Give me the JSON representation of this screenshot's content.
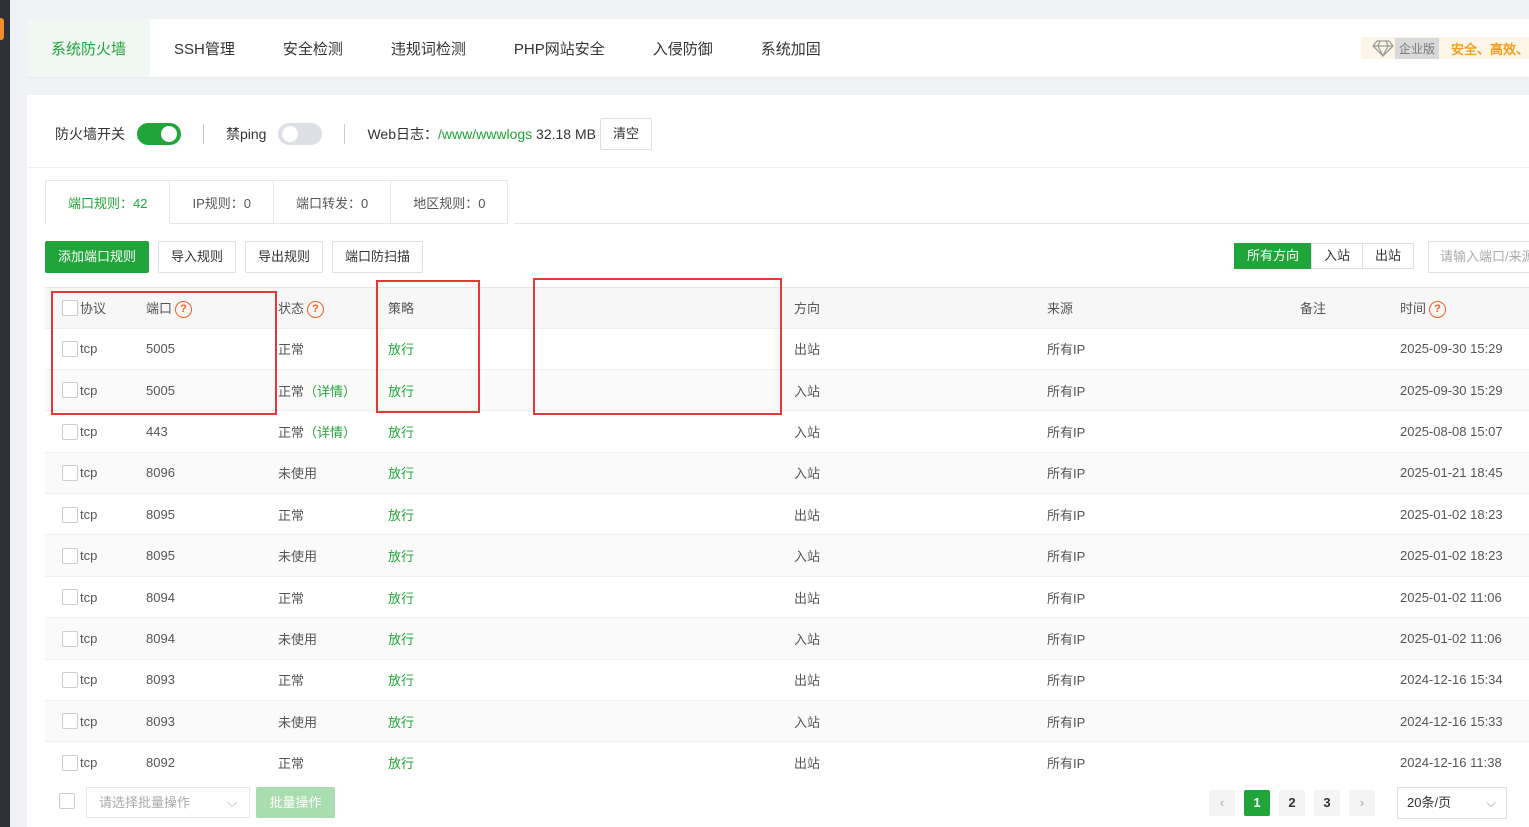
{
  "nav": {
    "tabs": [
      "系统防火墙",
      "SSH管理",
      "安全检测",
      "违规词检测",
      "PHP网站安全",
      "入侵防御",
      "系统加固"
    ],
    "active_index": 0,
    "enterprise": {
      "label": "企业版",
      "slogan": "安全、高效、"
    }
  },
  "switches": {
    "firewall_label": "防火墙开关",
    "firewall_on": true,
    "ping_label": "禁ping",
    "ping_on": false,
    "weblog_label": "Web日志：",
    "weblog_path": "/www/wwwlogs",
    "weblog_size": "32.18 MB",
    "clear_label": "清空"
  },
  "subtabs": [
    "端口规则：42",
    "IP规则：0",
    "端口转发：0",
    "地区规则：0"
  ],
  "toolbar": {
    "add_label": "添加端口规则",
    "import_label": "导入规则",
    "export_label": "导出规则",
    "scan_label": "端口防扫描"
  },
  "direction_filter": {
    "all": "所有方向",
    "in": "入站",
    "out": "出站"
  },
  "search": {
    "placeholder": "请输入端口/来源"
  },
  "table": {
    "headers": {
      "protocol": "协议",
      "port": "端口",
      "status": "状态",
      "policy": "策略",
      "direction": "方向",
      "source": "来源",
      "remark": "备注",
      "time": "时间"
    },
    "rows": [
      {
        "protocol": "tcp",
        "port": "5005",
        "status": "正常",
        "detail": "",
        "policy": "放行",
        "direction": "出站",
        "source": "所有IP",
        "remark": "",
        "time": "2025-09-30 15:29"
      },
      {
        "protocol": "tcp",
        "port": "5005",
        "status": "正常",
        "detail": "（详情）",
        "policy": "放行",
        "direction": "入站",
        "source": "所有IP",
        "remark": "",
        "time": "2025-09-30 15:29"
      },
      {
        "protocol": "tcp",
        "port": "443",
        "status": "正常",
        "detail": "（详情）",
        "policy": "放行",
        "direction": "入站",
        "source": "所有IP",
        "remark": "",
        "time": "2025-08-08 15:07"
      },
      {
        "protocol": "tcp",
        "port": "8096",
        "status": "未使用",
        "detail": "",
        "policy": "放行",
        "direction": "入站",
        "source": "所有IP",
        "remark": "",
        "time": "2025-01-21 18:45"
      },
      {
        "protocol": "tcp",
        "port": "8095",
        "status": "正常",
        "detail": "",
        "policy": "放行",
        "direction": "出站",
        "source": "所有IP",
        "remark": "",
        "time": "2025-01-02 18:23"
      },
      {
        "protocol": "tcp",
        "port": "8095",
        "status": "未使用",
        "detail": "",
        "policy": "放行",
        "direction": "入站",
        "source": "所有IP",
        "remark": "",
        "time": "2025-01-02 18:23"
      },
      {
        "protocol": "tcp",
        "port": "8094",
        "status": "正常",
        "detail": "",
        "policy": "放行",
        "direction": "出站",
        "source": "所有IP",
        "remark": "",
        "time": "2025-01-02 11:06"
      },
      {
        "protocol": "tcp",
        "port": "8094",
        "status": "未使用",
        "detail": "",
        "policy": "放行",
        "direction": "入站",
        "source": "所有IP",
        "remark": "",
        "time": "2025-01-02 11:06"
      },
      {
        "protocol": "tcp",
        "port": "8093",
        "status": "正常",
        "detail": "",
        "policy": "放行",
        "direction": "出站",
        "source": "所有IP",
        "remark": "",
        "time": "2024-12-16 15:34"
      },
      {
        "protocol": "tcp",
        "port": "8093",
        "status": "未使用",
        "detail": "",
        "policy": "放行",
        "direction": "入站",
        "source": "所有IP",
        "remark": "",
        "time": "2024-12-16 15:33"
      },
      {
        "protocol": "tcp",
        "port": "8092",
        "status": "正常",
        "detail": "",
        "policy": "放行",
        "direction": "出站",
        "source": "所有IP",
        "remark": "",
        "time": "2024-12-16 11:38"
      }
    ]
  },
  "footer": {
    "batch_select_placeholder": "请选择批量操作",
    "batch_button": "批量操作",
    "pages": [
      "1",
      "2",
      "3"
    ],
    "active_page": "1",
    "page_size": "20条/页"
  },
  "colors": {
    "accent": "#20a53a",
    "highlight_box": "#e53935",
    "help_icon": "#f0601f"
  }
}
